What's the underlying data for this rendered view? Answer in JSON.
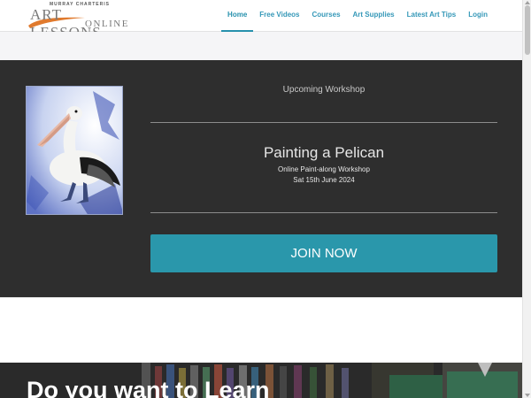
{
  "header": {
    "logo": {
      "small_text": "MURRAY CHARTERIS",
      "main_text": "ART LESSONS",
      "sub_text": "ONLINE"
    },
    "nav": [
      {
        "label": "Home",
        "active": true
      },
      {
        "label": "Free Videos",
        "active": false
      },
      {
        "label": "Courses",
        "active": false
      },
      {
        "label": "Art Supplies",
        "active": false
      },
      {
        "label": "Latest Art Tips",
        "active": false
      },
      {
        "label": "Login",
        "active": false
      }
    ]
  },
  "workshop": {
    "heading": "Upcoming Workshop",
    "title": "Painting a Pelican",
    "subtitle": "Online Paint-along Workshop",
    "date": "Sat 15th June 2024",
    "button_label": "JOIN NOW"
  },
  "hero": {
    "title": "Do you want to Learn"
  },
  "colors": {
    "accent": "#2a97ab",
    "nav_text": "#3598b8",
    "dark_bg": "#2e2e2e"
  }
}
